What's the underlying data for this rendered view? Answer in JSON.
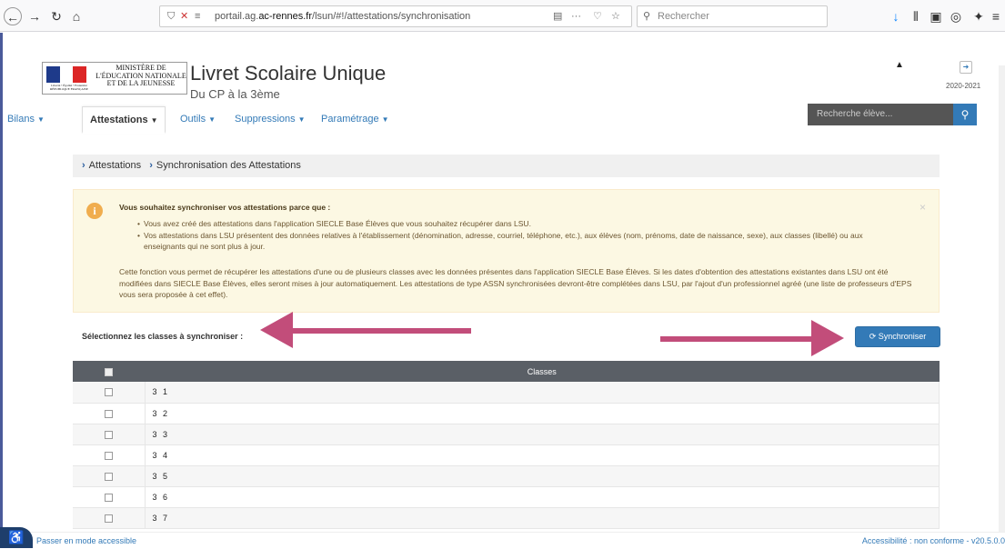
{
  "browser": {
    "url_prefix": "portail.ag.",
    "url_domain": "ac-rennes.fr",
    "url_path": "/lsun/#!/attestations/synchronisation",
    "search_placeholder": "Rechercher"
  },
  "header": {
    "ministry": "MINISTÈRE DE L'ÉDUCATION NATIONALE ET DE LA JEUNESSE",
    "flag_text": "Liberté • Égalité • Fraternité RÉPUBLIQUE FRANÇAISE",
    "app_title": "Livret Scolaire Unique",
    "app_subtitle": "Du CP à la 3ème",
    "year": "2020-2021",
    "student_search_placeholder": "Recherche élève..."
  },
  "nav": {
    "items": [
      {
        "label": "Bilans"
      },
      {
        "label": "Attestations"
      },
      {
        "label": "Outils"
      },
      {
        "label": "Suppressions"
      },
      {
        "label": "Paramétrage"
      }
    ]
  },
  "breadcrumb": {
    "items": [
      "Attestations",
      "Synchronisation des Attestations"
    ]
  },
  "alert": {
    "title": "Vous souhaitez synchroniser vos attestations parce que :",
    "bullets": [
      "Vous avez créé des attestations dans l'application SIECLE Base Élèves que vous souhaitez récupérer dans LSU.",
      "Vos attestations dans LSU présentent des données relatives à l'établissement (dénomination, adresse, courriel, téléphone, etc.), aux élèves (nom, prénoms, date de naissance, sexe), aux classes (libellé) ou aux enseignants qui ne sont plus à jour."
    ],
    "paragraph": "Cette fonction vous permet de récupérer les attestations d'une ou de plusieurs classes avec les données présentes dans l'application SIECLE Base Élèves. Si les dates d'obtention des attestations existantes dans LSU ont été modifiées dans SIECLE Base Élèves, elles seront mises à jour automatiquement. Les attestations de type ASSN synchronisées devront-être complétées dans LSU, par l'ajout d'un professionnel agréé (une liste de professeurs d'EPS vous sera proposée à cet effet)."
  },
  "sync": {
    "label": "Sélectionnez les classes à synchroniser :",
    "button": "Synchroniser"
  },
  "table": {
    "header": "Classes",
    "rows": [
      "3 1",
      "3 2",
      "3 3",
      "3 4",
      "3 5",
      "3 6",
      "3 7"
    ]
  },
  "footer": {
    "accessible_link": "Passer en mode accessible",
    "status": "Accessibilité : non conforme - v20.5.0.0"
  },
  "colors": {
    "primary": "#337ab7",
    "arrow": "#c24d7a",
    "alert_bg": "#fcf8e3",
    "table_header": "#5a5f66"
  }
}
